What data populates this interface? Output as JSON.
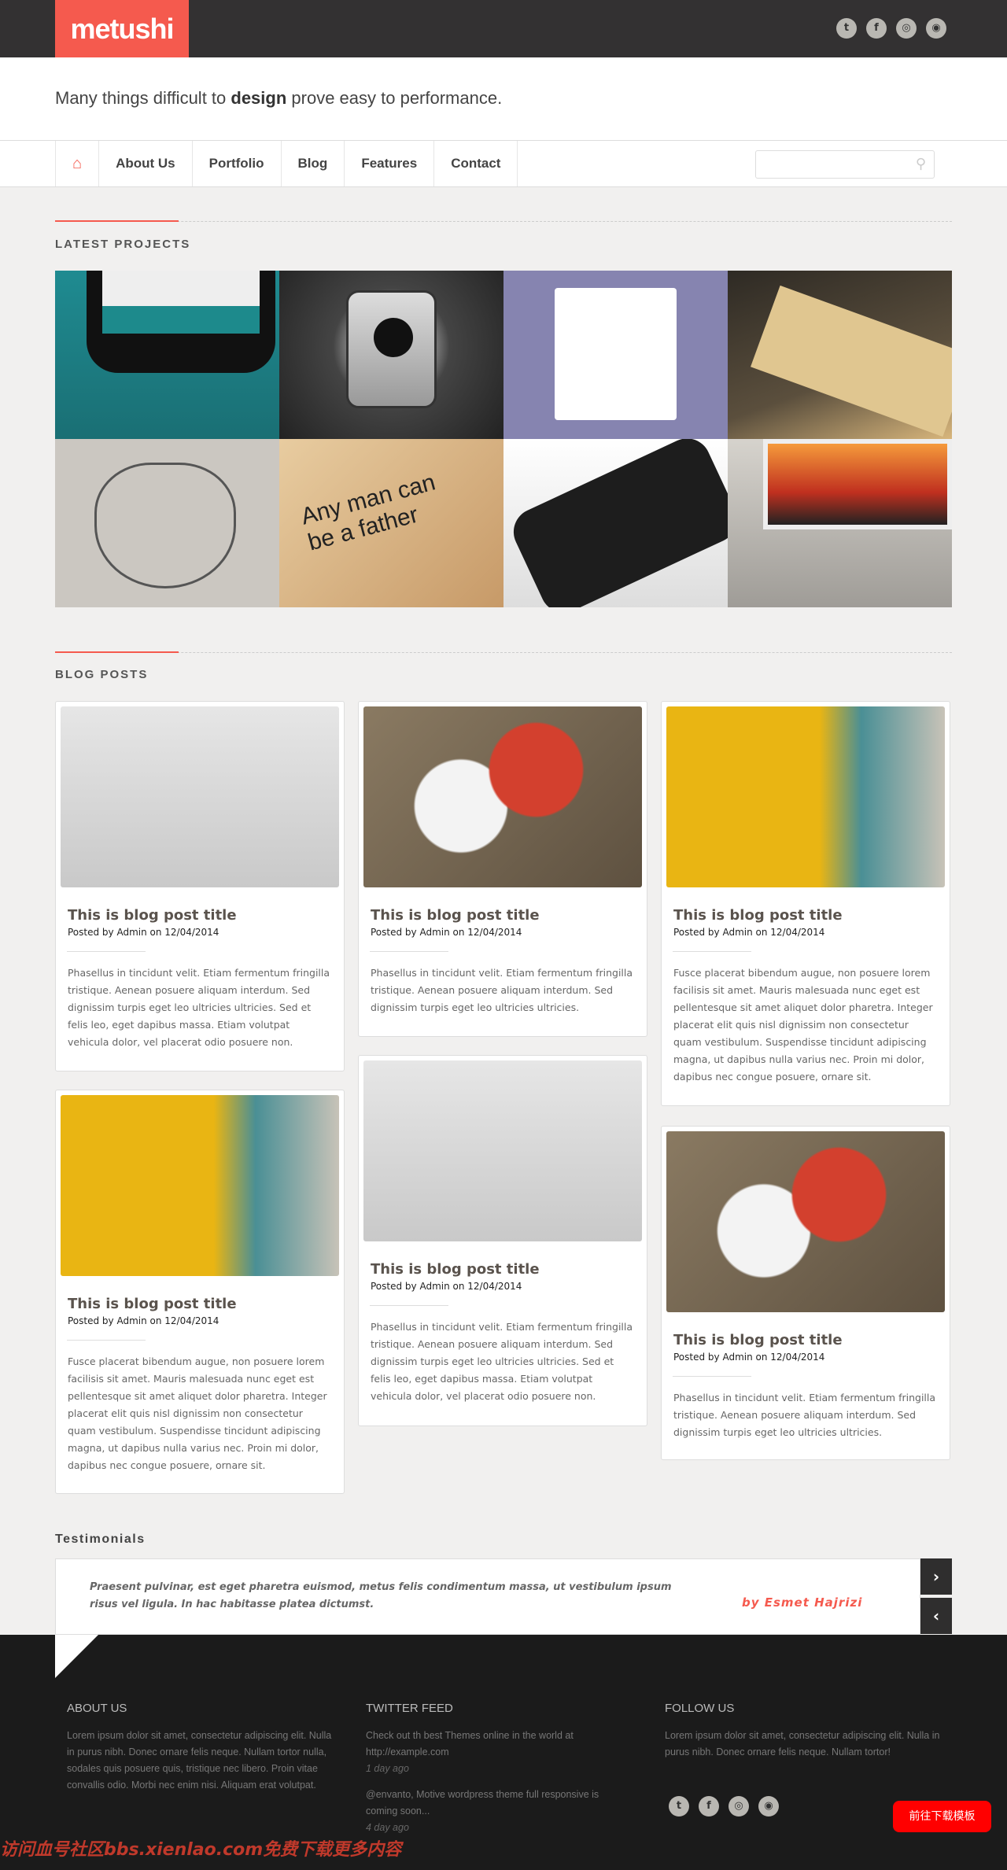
{
  "brand": {
    "logo": "metushi",
    "accent": "#f55a4e"
  },
  "header": {
    "social": [
      {
        "icon": "twitter-icon",
        "glyph": "t"
      },
      {
        "icon": "facebook-icon",
        "glyph": "f"
      },
      {
        "icon": "dribbble-icon",
        "glyph": "◎"
      },
      {
        "icon": "rss-icon",
        "glyph": "◉"
      }
    ]
  },
  "tagline": {
    "before": "Many things difficult to ",
    "bold": "design",
    "after": " prove easy to performance."
  },
  "nav": {
    "items": [
      "About Us",
      "Portfolio",
      "Blog",
      "Features",
      "Contact"
    ],
    "search_placeholder": ""
  },
  "latest": {
    "title": "LATEST PROJECTS",
    "projects": [
      "iPhone app",
      "GoPro HERO3 camera",
      "Category list UI",
      "Visit card",
      "Sketch emblem",
      "Quote typography",
      "iPhone sign in",
      "Sunset blog"
    ]
  },
  "blog": {
    "title": "BLOG POSTS",
    "posts": [
      {
        "title": "This is blog post title",
        "meta": "Posted by Admin on 12/04/2014",
        "text": "Phasellus in tincidunt velit. Etiam fermentum fringilla tristique. Aenean posuere aliquam interdum. Sed dignissim turpis eget leo ultricies ultricies. Sed et felis leo, eget dapibus massa. Etiam volutpat vehicula dolor, vel placerat odio posuere non."
      },
      {
        "title": "This is blog post title",
        "meta": "Posted by Admin on 12/04/2014",
        "text": "Phasellus in tincidunt velit. Etiam fermentum fringilla tristique. Aenean posuere aliquam interdum. Sed dignissim turpis eget leo ultricies ultricies."
      },
      {
        "title": "This is blog post title",
        "meta": "Posted by Admin on 12/04/2014",
        "text": "Fusce placerat bibendum augue, non posuere lorem facilisis sit amet. Mauris malesuada nunc eget est pellentesque sit amet aliquet dolor pharetra. Integer placerat elit quis nisl dignissim non consectetur quam vestibulum. Suspendisse tincidunt adipiscing magna, ut dapibus nulla varius nec. Proin mi dolor, dapibus nec congue posuere, ornare sit."
      },
      {
        "title": "This is blog post title",
        "meta": "Posted by Admin on 12/04/2014",
        "text": "Fusce placerat bibendum augue, non posuere lorem facilisis sit amet. Mauris malesuada nunc eget est pellentesque sit amet aliquet dolor pharetra. Integer placerat elit quis nisl dignissim non consectetur quam vestibulum. Suspendisse tincidunt adipiscing magna, ut dapibus nulla varius nec. Proin mi dolor, dapibus nec congue posuere, ornare sit."
      },
      {
        "title": "This is blog post title",
        "meta": "Posted by Admin on 12/04/2014",
        "text": "Phasellus in tincidunt velit. Etiam fermentum fringilla tristique. Aenean posuere aliquam interdum. Sed dignissim turpis eget leo ultricies ultricies. Sed et felis leo, eget dapibus massa. Etiam volutpat vehicula dolor, vel placerat odio posuere non."
      },
      {
        "title": "This is blog post title",
        "meta": "Posted by Admin on 12/04/2014",
        "text": "Phasellus in tincidunt velit. Etiam fermentum fringilla tristique. Aenean posuere aliquam interdum. Sed dignissim turpis eget leo ultricies ultricies."
      }
    ]
  },
  "testimonials": {
    "title": "Testimonials",
    "quote": "Praesent pulvinar, est eget pharetra euismod, metus felis condimentum massa, ut vestibulum ipsum risus vel ligula. In hac habitasse platea dictumst.",
    "author": "by Esmet Hajrizi",
    "next": "›",
    "prev": "‹"
  },
  "footer": {
    "about": {
      "title": "ABOUT US",
      "text": "Lorem ipsum dolor sit amet, consectetur adipiscing elit. Nulla in purus nibh. Donec ornare felis neque. Nullam tortor nulla, sodales quis posuere quis, tristique nec libero. Proin vitae convallis odio. Morbi nec enim nisi. Aliquam erat volutpat."
    },
    "twitter": {
      "title": "TWITTER FEED",
      "tweets": [
        {
          "text": "Check out th best Themes online in the world at http://example.com",
          "time": "1 day ago"
        },
        {
          "text": "@envanto, Motive wordpress theme full responsive is coming soon...",
          "time": "4 day ago"
        }
      ]
    },
    "follow": {
      "title": "FOLLOW US",
      "text": "Lorem ipsum dolor sit amet, consectetur adipiscing elit. Nulla in purus nibh. Donec ornare felis neque. Nullam tortor!"
    },
    "download_button": "前往下载模板",
    "watermark": "访问血号社区bbs.xienlao.com免费下载更多内容"
  }
}
